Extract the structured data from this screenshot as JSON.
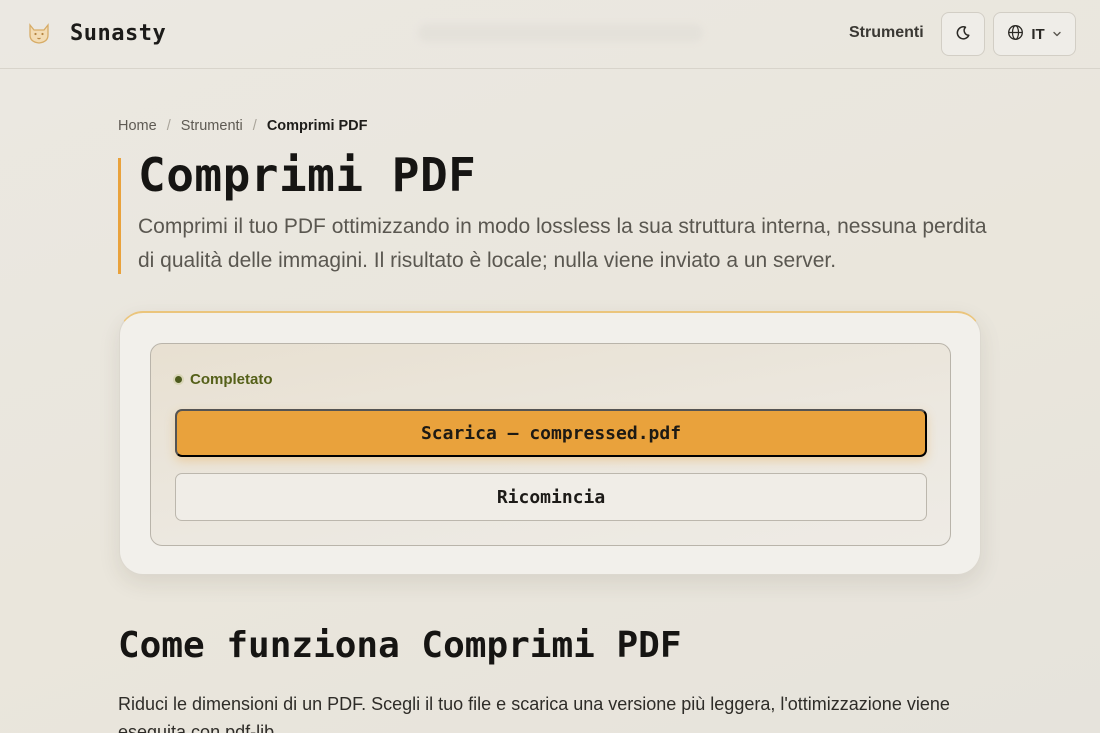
{
  "header": {
    "brand": "Sunasty",
    "nav_tools": "Strumenti",
    "theme_icon": "moon-icon",
    "language": "IT",
    "language_icon": "globe-icon"
  },
  "breadcrumb": {
    "items": [
      "Home",
      "Strumenti",
      "Comprimi PDF"
    ],
    "separator": "/"
  },
  "hero": {
    "title": "Comprimi PDF",
    "description": "Comprimi il tuo PDF ottimizzando in modo lossless la sua struttura interna, nessuna perdita di qualità delle immagini. Il risultato è locale; nulla viene inviato a un server."
  },
  "result": {
    "status": "Completato",
    "download_label": "Scarica — compressed.pdf",
    "restart_label": "Ricomincia"
  },
  "how_it_works": {
    "title": "Come funziona Comprimi PDF",
    "text": "Riduci le dimensioni di un PDF. Scegli il tuo file e scarica una versione più leggera, l'ottimizzazione viene eseguita con pdf-lib."
  },
  "colors": {
    "accent": "#e9a23c",
    "status_green": "#556019",
    "background": "#ebe8e2"
  }
}
